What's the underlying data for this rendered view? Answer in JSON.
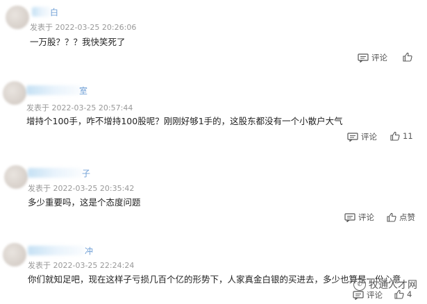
{
  "comments": [
    {
      "name_suffix": "白",
      "meta": "发表于 2022-03-25 20:26:06",
      "text": "一万股？？？我快笑死了",
      "reply_label": "评论",
      "like_label": ""
    },
    {
      "name_suffix": "室",
      "meta": "发表于 2022-03-25 20:57:44",
      "text": "增持个100手，咋不增持100股呢？刚刚好够1手的，这股东都没有一个小散户大气",
      "reply_label": "评论",
      "like_label": "11"
    },
    {
      "name_suffix": "子",
      "meta": "发表于 2022-03-25 20:35:42",
      "text": "多少重要吗，这是个态度问题",
      "reply_label": "评论",
      "like_label": "点赞"
    },
    {
      "name_suffix": "冲",
      "meta": "发表于 2022-03-25 22:24:24",
      "text": "你们就知足吧，现在这样子亏损几百个亿的形势下，人家真金白银的买进去，多少也算是一份心意",
      "reply_label": "评论",
      "like_label": "4"
    }
  ],
  "watermark": {
    "text": "牧通人才网",
    "icon": "wechat-icon"
  }
}
